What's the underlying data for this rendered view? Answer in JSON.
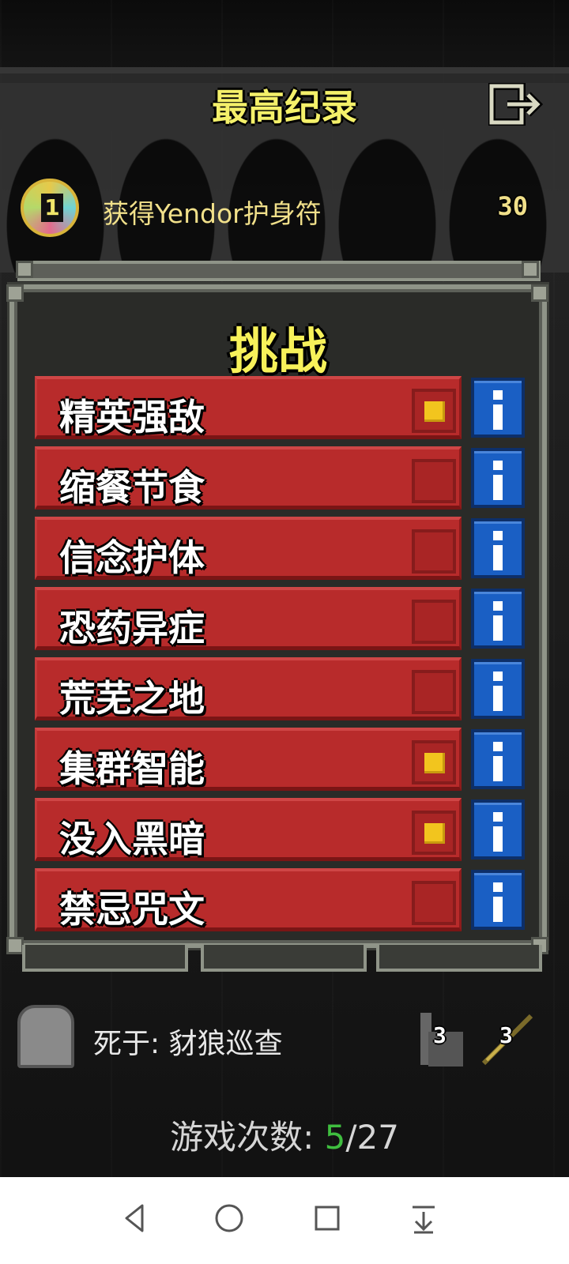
{
  "header": {
    "title": "最高纪录"
  },
  "record": {
    "text": "获得Yendor护身符",
    "badge": "1",
    "score": "30"
  },
  "dialog": {
    "title": "挑战",
    "challenges": [
      {
        "label": "精英强敌",
        "checked": true
      },
      {
        "label": "缩餐节食",
        "checked": false
      },
      {
        "label": "信念护体",
        "checked": false
      },
      {
        "label": "恐药异症",
        "checked": false
      },
      {
        "label": "荒芜之地",
        "checked": false
      },
      {
        "label": "集群智能",
        "checked": true
      },
      {
        "label": "没入黑暗",
        "checked": true
      },
      {
        "label": "禁忌咒文",
        "checked": false
      }
    ]
  },
  "death": {
    "text": "死于: 豺狼巡查",
    "stat1": "3",
    "stat2": "3"
  },
  "games": {
    "label": "游戏次数: ",
    "current": "5",
    "total": "/27"
  },
  "colors": {
    "accent_yellow": "#f7f15a",
    "challenge_red": "#b82b2b",
    "info_blue": "#1a5fc4",
    "games_green": "#3fbe3f"
  },
  "icons": [
    "exit-icon",
    "amulet-icon",
    "checkbox",
    "info-icon",
    "tombstone-icon",
    "depth-icon",
    "weapon-icon",
    "back-icon",
    "home-icon",
    "recents-icon",
    "notification-icon"
  ]
}
